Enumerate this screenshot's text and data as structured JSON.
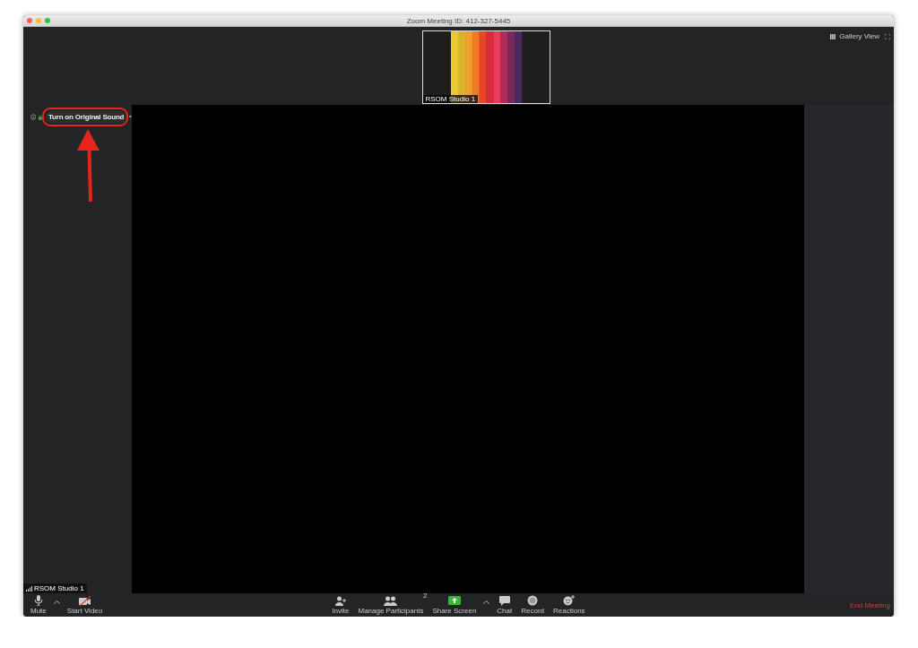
{
  "window": {
    "title": "Zoom Meeting ID: 412-327-5445"
  },
  "top_bar": {
    "view_button": "Gallery View"
  },
  "thumbnail": {
    "name": "RSOM Studio 1",
    "kind": "picture"
  },
  "audio_notice": {
    "button": "Turn on Original Sound"
  },
  "self_view": {
    "name": "RSOM Studio 1"
  },
  "toolbar": {
    "left": [
      {
        "kind": "mic",
        "label": "Mute"
      },
      {
        "kind": "caret"
      },
      {
        "kind": "video_off",
        "label": "Start Video"
      }
    ],
    "center": [
      {
        "kind": "invite",
        "label": "Invite"
      },
      {
        "kind": "participants",
        "label": "Manage Participants",
        "count": "2"
      },
      {
        "kind": "share",
        "label": "Share Screen"
      },
      {
        "kind": "caret"
      },
      {
        "kind": "chat",
        "label": "Chat"
      },
      {
        "kind": "record",
        "label": "Record"
      },
      {
        "kind": "reactions",
        "label": "Reactions"
      }
    ],
    "end_button": "End Meeting"
  }
}
